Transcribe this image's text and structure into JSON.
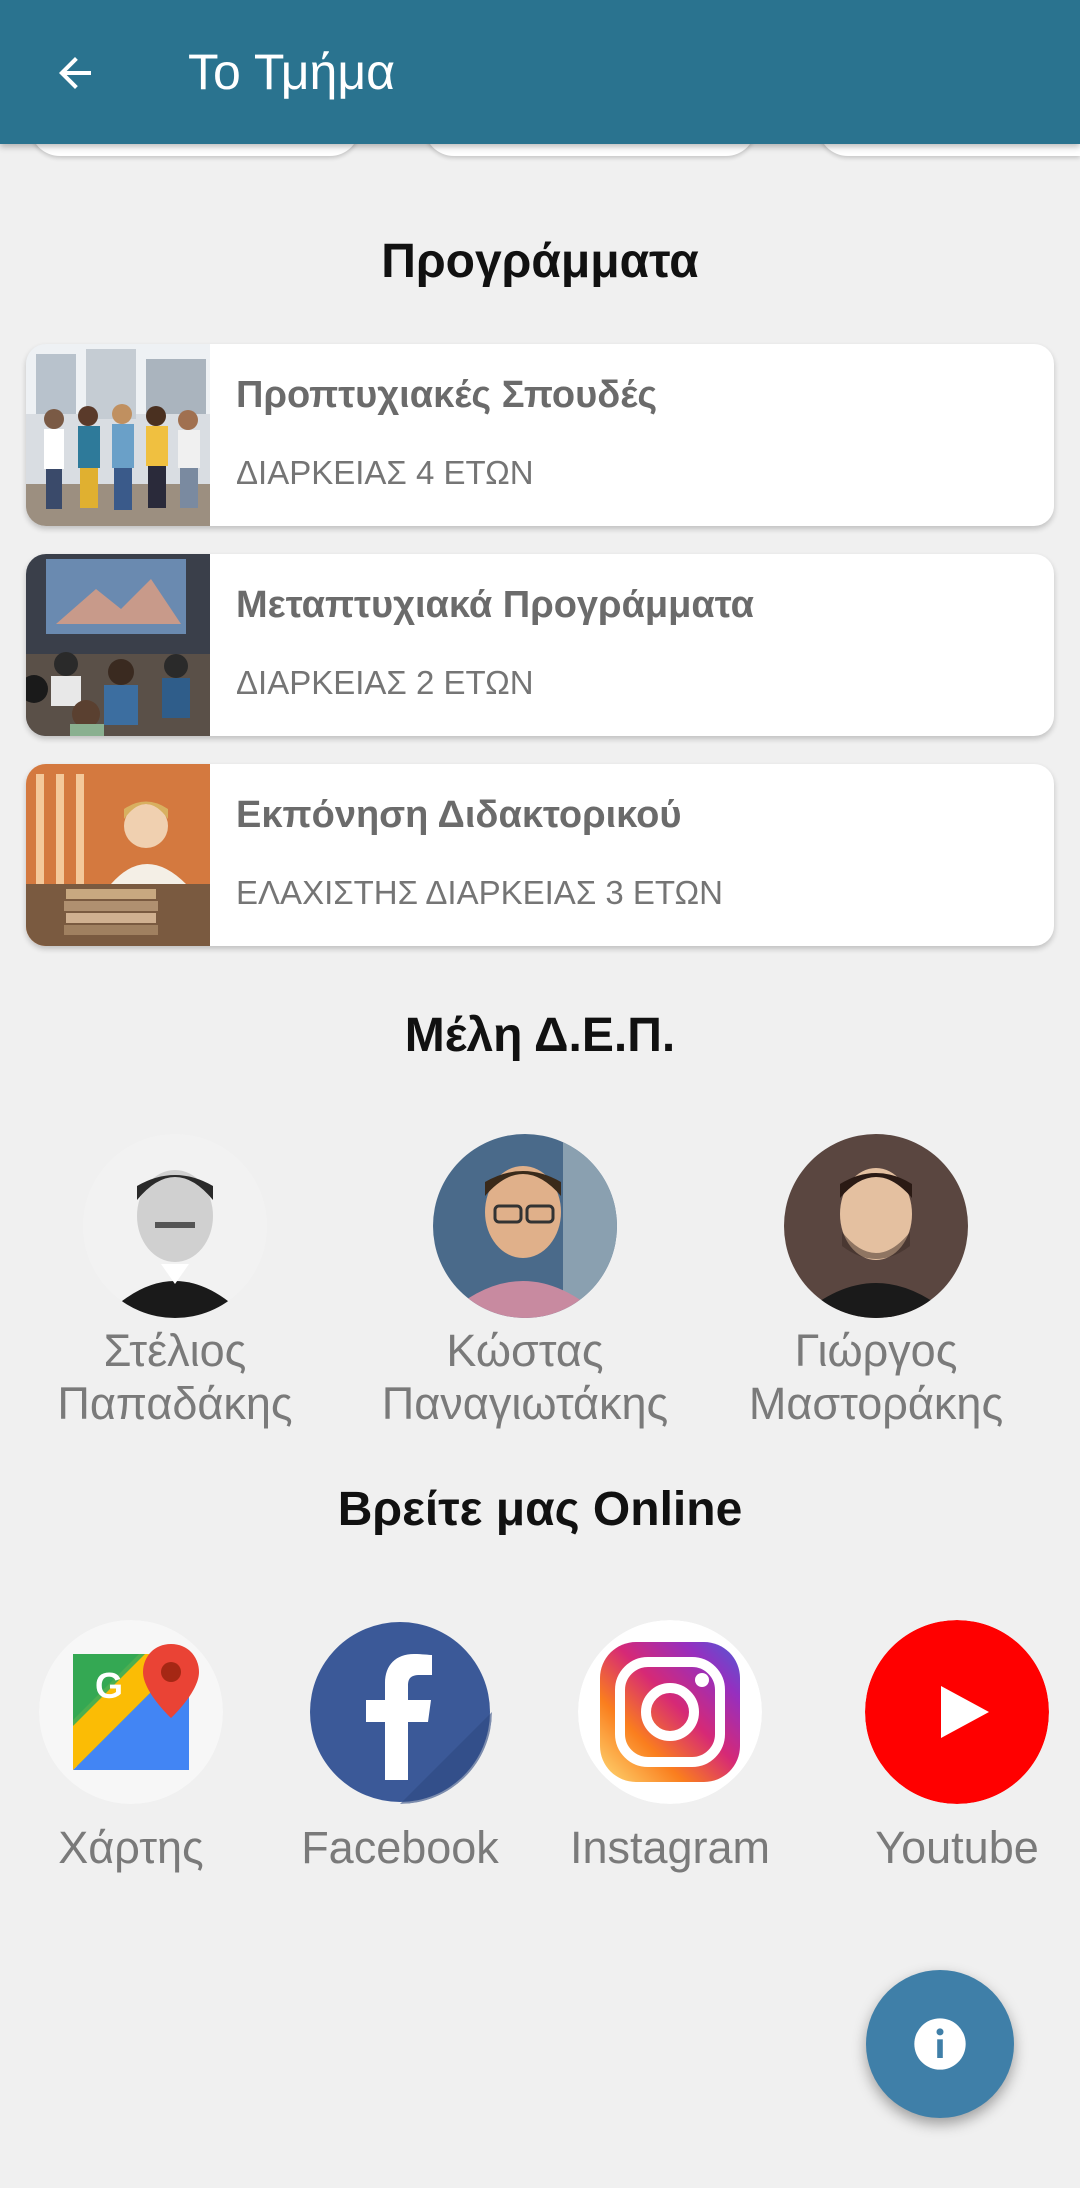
{
  "app_bar": {
    "title": "Το Τμήμα",
    "back_icon": "arrow-back-icon"
  },
  "programs": {
    "heading": "Προγράμματα",
    "items": [
      {
        "title": "Προπτυχιακές Σπουδές",
        "subtitle": "ΔΙΑΡΚΕΙΑΣ 4 ΕΤΩΝ"
      },
      {
        "title": "Μεταπτυχιακά Προγράμματα",
        "subtitle": "ΔΙΑΡΚΕΙΑΣ 2 ΕΤΩΝ"
      },
      {
        "title": "Εκπόνηση Διδακτορικού",
        "subtitle": "ΕΛΑΧΙΣΤΗΣ ΔΙΑΡΚΕΙΑΣ 3 ΕΤΩΝ"
      }
    ]
  },
  "members": {
    "heading": "Μέλη Δ.Ε.Π.",
    "items": [
      {
        "first": "Στέλιος",
        "last": "Παπαδάκης"
      },
      {
        "first": "Κώστας",
        "last": "Παναγιωτάκης"
      },
      {
        "first": "Γιώργος",
        "last": "Μαστοράκης"
      }
    ]
  },
  "online": {
    "heading": "Βρείτε μας Online",
    "items": [
      {
        "label": "Χάρτης",
        "icon": "google-maps-icon"
      },
      {
        "label": "Facebook",
        "icon": "facebook-icon"
      },
      {
        "label": "Instagram",
        "icon": "instagram-icon"
      },
      {
        "label": "Youtube",
        "icon": "youtube-icon"
      }
    ]
  },
  "fab": {
    "icon": "info-icon"
  },
  "colors": {
    "app_bar": "#2a738f",
    "fab": "#3f7fa8",
    "youtube": "#ff0000",
    "facebook": "#3b5998"
  }
}
